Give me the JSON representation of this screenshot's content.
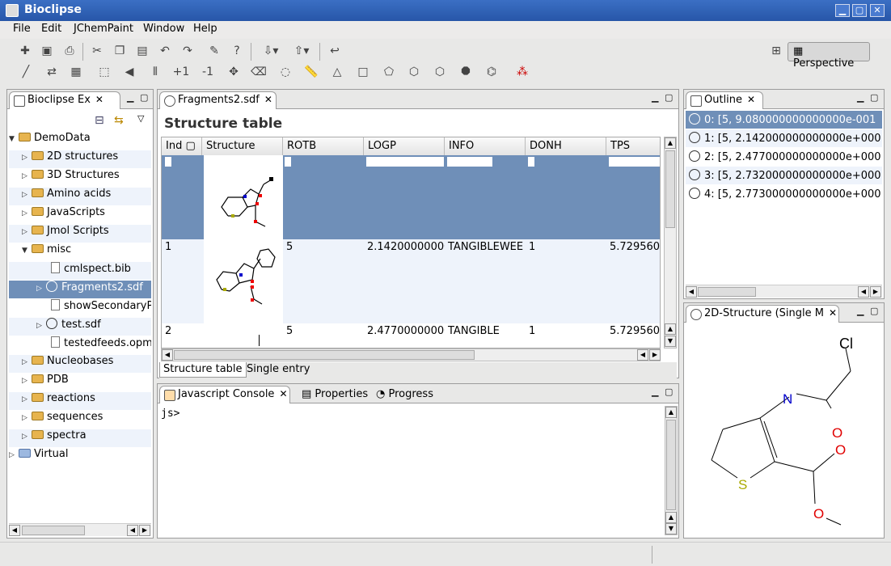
{
  "window": {
    "title": "Bioclipse",
    "min": "▁",
    "max": "▢",
    "close": "✕"
  },
  "menu": [
    "File",
    "Edit",
    "JChemPaint",
    "Window",
    "Help"
  ],
  "perspective": {
    "label": "Perspective"
  },
  "draw_tools": {
    "plus1": "+1",
    "minus1": "-1"
  },
  "navigator": {
    "tab": "Bioclipse Ex",
    "root": "DemoData",
    "items": [
      "2D structures",
      "3D Structures",
      "Amino acids",
      "JavaScripts",
      "Jmol Scripts",
      "misc",
      "cmlspect.bib",
      "Fragments2.sdf",
      "showSecondaryP",
      "test.sdf",
      "testedfeeds.opm",
      "Nucleobases",
      "PDB",
      "reactions",
      "sequences",
      "spectra",
      "Virtual"
    ]
  },
  "editor": {
    "tab": "Fragments2.sdf",
    "heading": "Structure table",
    "columns": [
      "Ind",
      "Structure",
      "ROTB",
      "LOGP",
      "INFO",
      "DONH",
      "TPS"
    ],
    "rows": [
      {
        "index": "",
        "rotb": "",
        "logp": "",
        "info": "",
        "donh": "",
        "tps": ""
      },
      {
        "index": "1",
        "rotb": "5",
        "logp": "2.1420000000C",
        "info": "TANGIBLEWEE",
        "donh": "1",
        "tps": "5.729560"
      },
      {
        "index": "2",
        "rotb": "5",
        "logp": "2.4770000000C",
        "info": "TANGIBLE",
        "donh": "1",
        "tps": "5.729560"
      }
    ],
    "bottom_tabs": [
      "Structure table",
      "Single entry"
    ]
  },
  "console": {
    "tabs": [
      "Javascript Console",
      "Properties",
      "Progress"
    ],
    "prompt": "js>"
  },
  "outline": {
    "tab": "Outline",
    "rows": [
      "0: [5, 9.080000000000000e-001",
      "1: [5, 2.142000000000000e+000",
      "2: [5, 2.477000000000000e+000",
      "3: [5, 2.732000000000000e+000",
      "4: [5, 2.773000000000000e+000"
    ]
  },
  "structure2d": {
    "tab": "2D-Structure (Single M",
    "atoms": {
      "cl": "Cl",
      "n": "N",
      "o1": "O",
      "o2": "O",
      "s": "S",
      "o3": "O"
    }
  },
  "colors": {
    "title": "#2756a8",
    "selection": "#6f8fb8",
    "n": "#0000cc",
    "o": "#e00000",
    "s": "#aaaa00"
  }
}
